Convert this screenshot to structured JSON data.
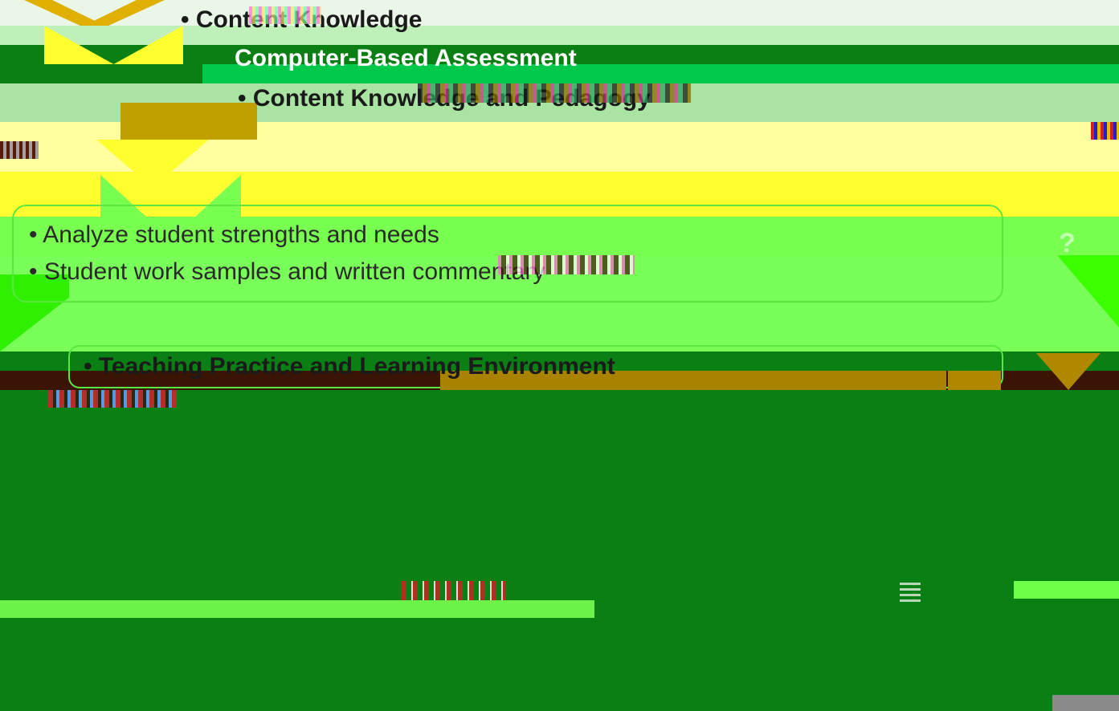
{
  "slide": {
    "line1": "• Content Knowledge",
    "line2": "Computer-Based Assessment",
    "line3": "• Content Knowledge and Pedagogy",
    "line4": "• Analyze student strengths and needs",
    "line5": "• Student work samples and written commentary",
    "line6": "• Teaching Practice and Learning Environment",
    "icon_q": "?"
  },
  "colors": {
    "top_white": "#e9f6e6",
    "band_green": "#0a7f14",
    "mid_green": "#00c84a",
    "light_green": "#a6e5a0",
    "yellow": "#ffff30",
    "lime": "#78ff50",
    "dark_brown": "#3a1506",
    "gold": "#b89a00",
    "deep_green": "#0a7f14",
    "gray": "#8a8a8a"
  }
}
